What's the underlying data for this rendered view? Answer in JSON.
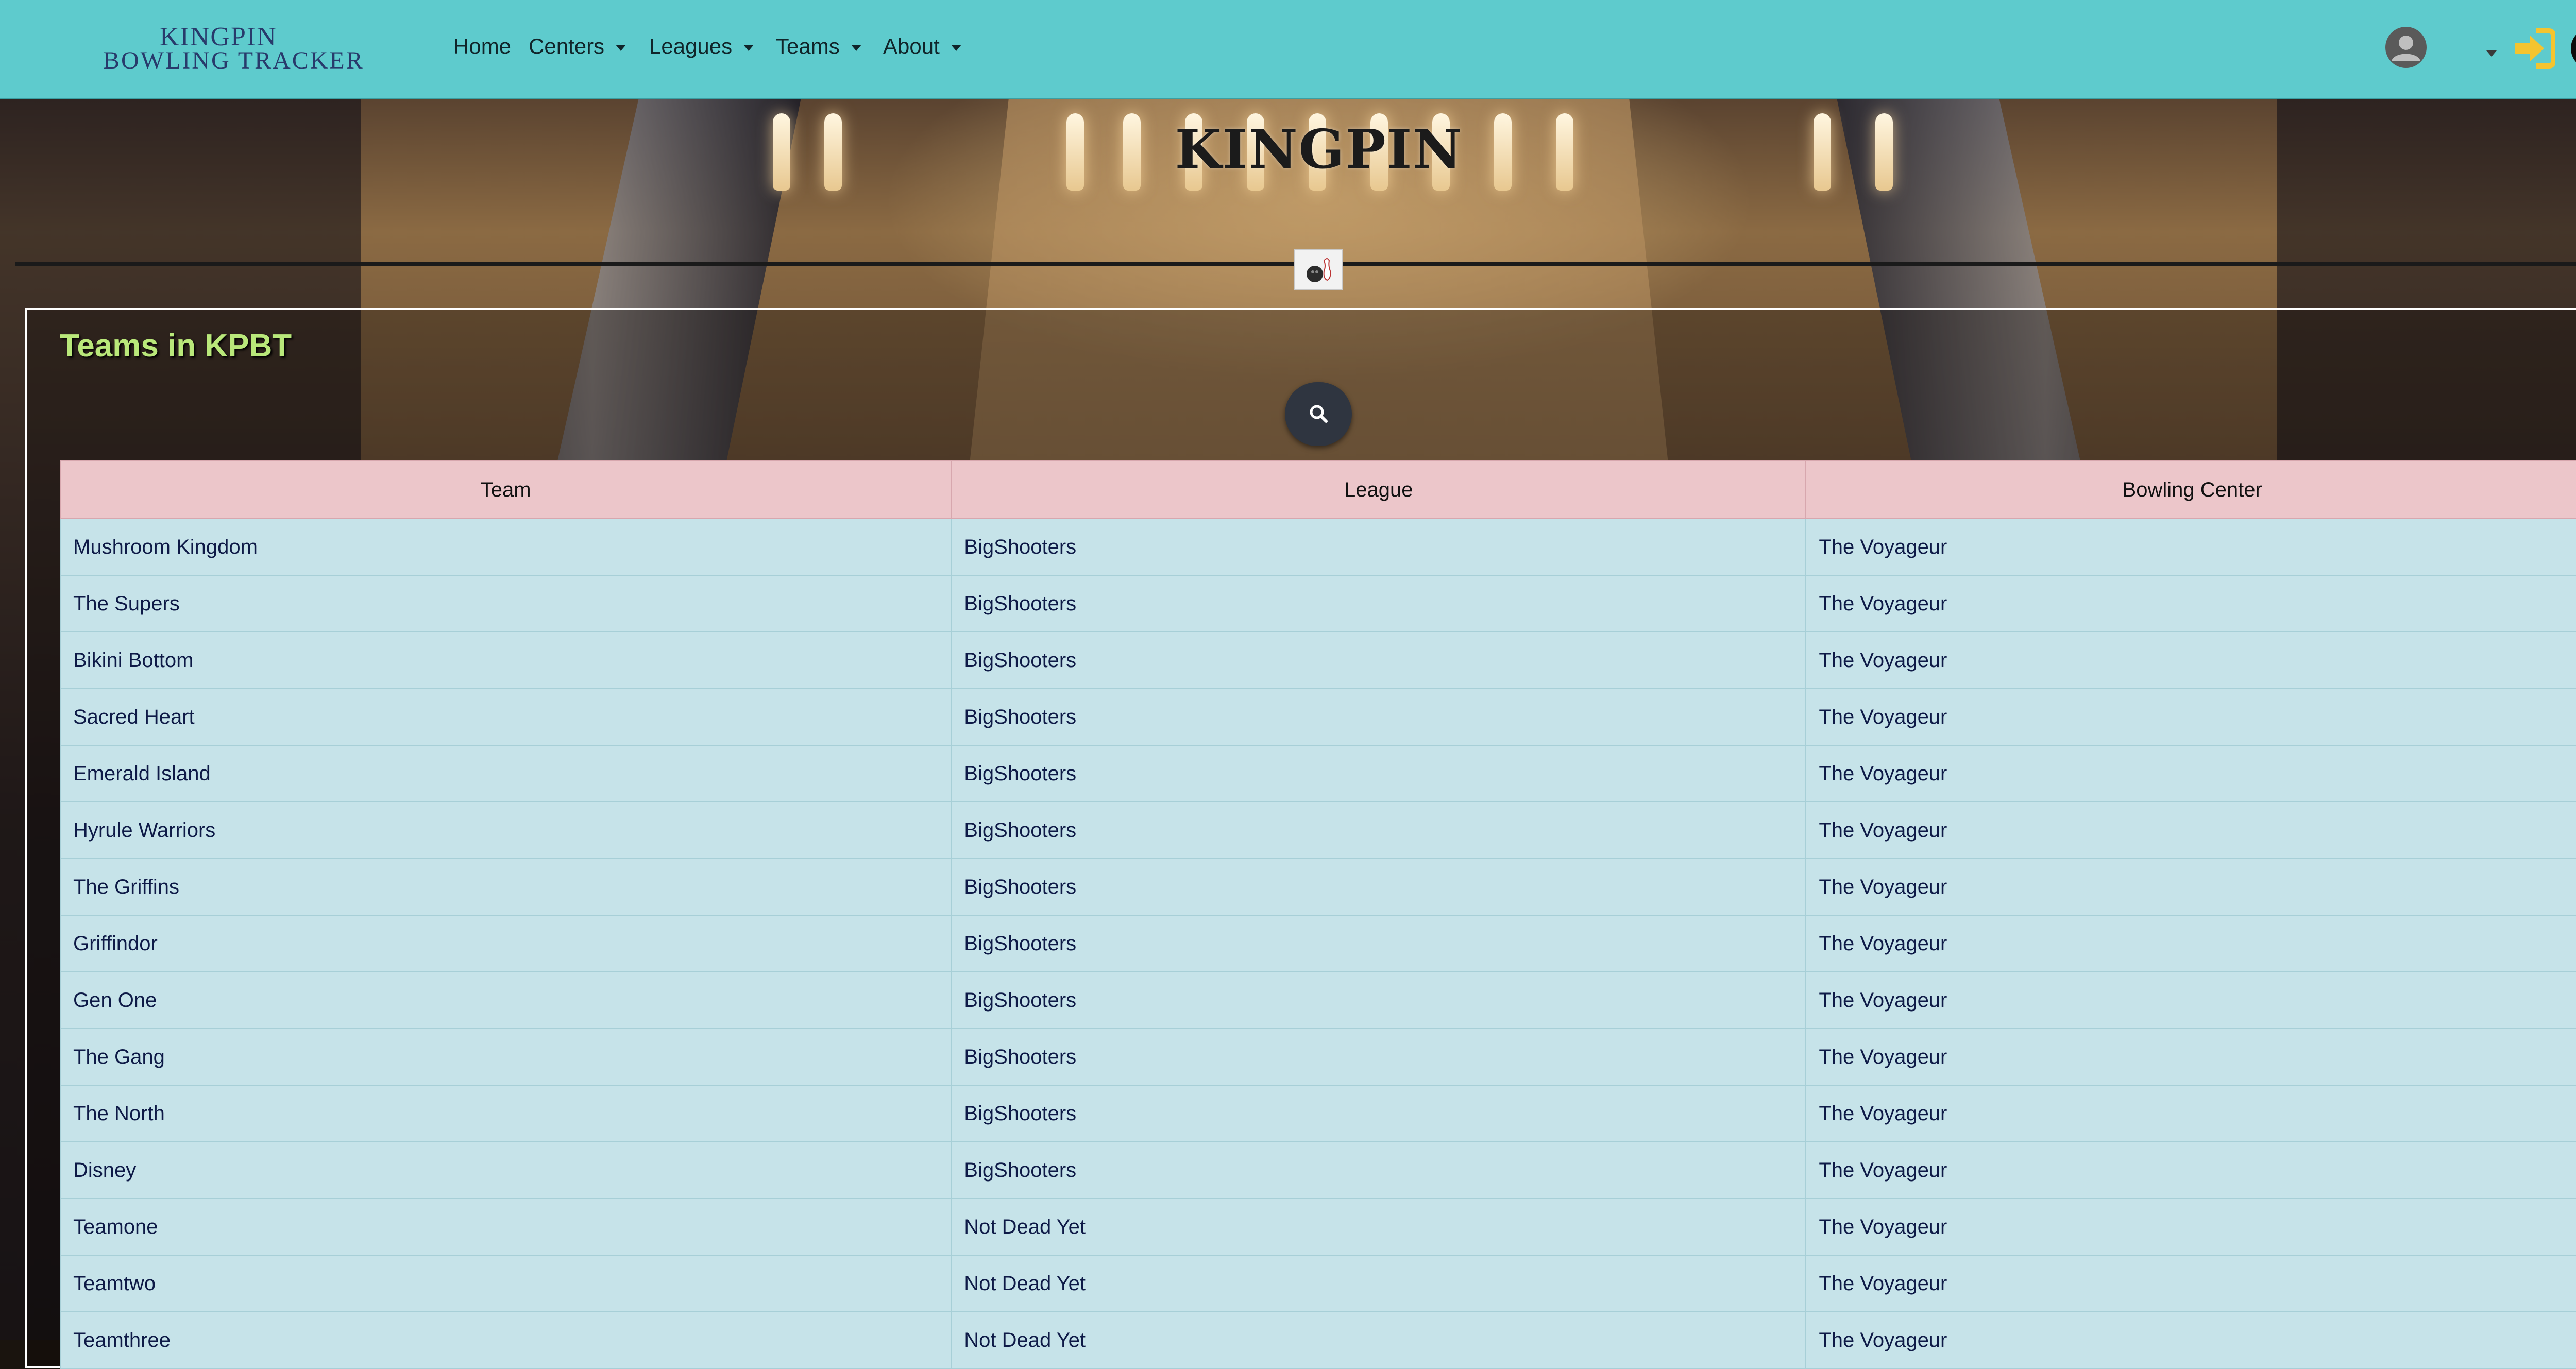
{
  "navbar": {
    "logo_line1": "KINGPIN",
    "logo_line2": "BOWLING TRACKER",
    "items": [
      {
        "label": "Home",
        "dropdown": false
      },
      {
        "label": "Centers",
        "dropdown": true
      },
      {
        "label": "Leagues",
        "dropdown": true
      },
      {
        "label": "Teams",
        "dropdown": true
      },
      {
        "label": "About",
        "dropdown": true
      }
    ],
    "right_icons": [
      "user-icon",
      "login-icon",
      "bowling-ball-icon"
    ],
    "accent_color": "#5ecbcd"
  },
  "header": {
    "brand_title": "KINGPIN"
  },
  "main": {
    "card_title": "Teams in KPBT",
    "search_icon": "search-icon",
    "table": {
      "columns": [
        "Team",
        "League",
        "Bowling Center"
      ],
      "rows": [
        [
          "Mushroom Kingdom",
          "BigShooters",
          "The Voyageur"
        ],
        [
          "The Supers",
          "BigShooters",
          "The Voyageur"
        ],
        [
          "Bikini Bottom",
          "BigShooters",
          "The Voyageur"
        ],
        [
          "Sacred Heart",
          "BigShooters",
          "The Voyageur"
        ],
        [
          "Emerald Island",
          "BigShooters",
          "The Voyageur"
        ],
        [
          "Hyrule Warriors",
          "BigShooters",
          "The Voyageur"
        ],
        [
          "The Griffins",
          "BigShooters",
          "The Voyageur"
        ],
        [
          "Griffindor",
          "BigShooters",
          "The Voyageur"
        ],
        [
          "Gen One",
          "BigShooters",
          "The Voyageur"
        ],
        [
          "The Gang",
          "BigShooters",
          "The Voyageur"
        ],
        [
          "The North",
          "BigShooters",
          "The Voyageur"
        ],
        [
          "Disney",
          "BigShooters",
          "The Voyageur"
        ],
        [
          "Teamone",
          "Not Dead Yet",
          "The Voyageur"
        ],
        [
          "Teamtwo",
          "Not Dead Yet",
          "The Voyageur"
        ],
        [
          "Teamthree",
          "Not Dead Yet",
          "The Voyageur"
        ]
      ]
    }
  }
}
